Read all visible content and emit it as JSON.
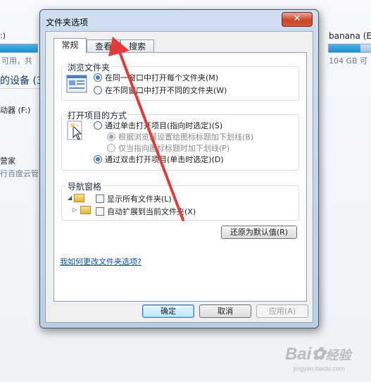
{
  "background": {
    "left_texts": [
      ":)",
      "可用，共",
      "的设备 (3)",
      "动器 (F:)",
      "营家",
      "行百度云管"
    ],
    "right_drive_name": "banana (E:",
    "right_drive_size": "104 GB 可",
    "right_drive_usage": 0.7
  },
  "dialog": {
    "title": "文件夹选项",
    "close_symbol": "✕",
    "tabs": [
      "常规",
      "查看",
      "搜索"
    ],
    "active_tab": "常规",
    "browse_group": {
      "title": "浏览文件夹",
      "options": [
        {
          "label": "在同一窗口中打开每个文件夹(M)",
          "checked": true
        },
        {
          "label": "在不同窗口中打开不同的文件夹(W)",
          "checked": false
        }
      ]
    },
    "click_group": {
      "title": "打开项目的方式",
      "single_click": {
        "label": "通过单击打开项目(指向时选定)(S)",
        "checked": false
      },
      "underline_browser": {
        "label": "根据浏览器设置给图标标题加下划线(B)",
        "checked": true,
        "disabled": true
      },
      "underline_point": {
        "label": "仅当指向图标标题时加下划线(P)",
        "checked": false,
        "disabled": true
      },
      "double_click": {
        "label": "通过双击打开项目(单击时选定)(D)",
        "checked": true
      }
    },
    "nav_group": {
      "title": "导航窗格",
      "show_all": {
        "label": "显示所有文件夹(L)",
        "checked": false
      },
      "auto_expand": {
        "label": "自动扩展到当前文件夹(X)",
        "checked": false
      }
    },
    "restore_button": "还原为默认值(R)",
    "help_link": "我如何更改文件夹选项?",
    "ok_button": "确定",
    "cancel_button": "取消",
    "apply_button": "应用(A)"
  },
  "watermark": {
    "brand": "Bai",
    "brand2": "经验",
    "site": "jingyan.baidu.com"
  },
  "colors": {
    "arrow": "#e23b3b",
    "accent": "#1a57a6"
  }
}
